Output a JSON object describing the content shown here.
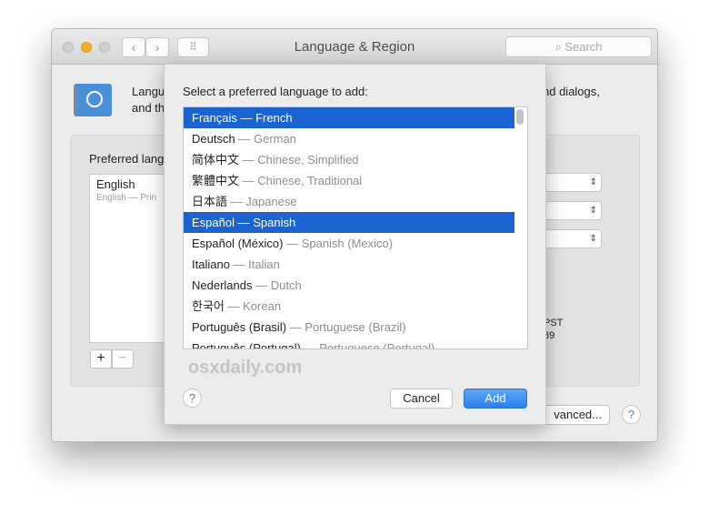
{
  "window": {
    "title": "Language & Region",
    "search_placeholder": "Search",
    "nav_back": "‹",
    "nav_forward": "›",
    "grid": "⠿"
  },
  "header": {
    "text_left_1": "Langu",
    "text_left_2": "and th",
    "text_right": "nd dialogs,"
  },
  "preferred": {
    "label": "Preferred lang",
    "items": [
      {
        "name": "English",
        "detail": "English — Prin"
      }
    ],
    "add": "+",
    "remove": "−"
  },
  "right_fragments": {
    "line1": "PST",
    "line2": "89"
  },
  "advanced_label": "vanced...",
  "help": "?",
  "sheet": {
    "prompt": "Select a preferred language to add:",
    "languages": [
      {
        "native": "Français",
        "english": "French",
        "selected": true
      },
      {
        "native": "Deutsch",
        "english": "German",
        "selected": false
      },
      {
        "native": "简体中文",
        "english": "Chinese, Simplified",
        "selected": false
      },
      {
        "native": "繁體中文",
        "english": "Chinese, Traditional",
        "selected": false
      },
      {
        "native": "日本語",
        "english": "Japanese",
        "selected": false
      },
      {
        "native": "Español",
        "english": "Spanish",
        "selected": true
      },
      {
        "native": "Español (México)",
        "english": "Spanish (Mexico)",
        "selected": false
      },
      {
        "native": "Italiano",
        "english": "Italian",
        "selected": false
      },
      {
        "native": "Nederlands",
        "english": "Dutch",
        "selected": false
      },
      {
        "native": "한국어",
        "english": "Korean",
        "selected": false
      },
      {
        "native": "Português (Brasil)",
        "english": "Portuguese (Brazil)",
        "selected": false
      },
      {
        "native": "Português (Portugal)",
        "english": "Portuguese (Portugal)",
        "selected": false
      }
    ],
    "separator": "—",
    "watermark": "osxdaily.com",
    "cancel": "Cancel",
    "add": "Add",
    "help": "?"
  },
  "colors": {
    "selection": "#1a64d1",
    "add_button": "#2f86f0"
  }
}
